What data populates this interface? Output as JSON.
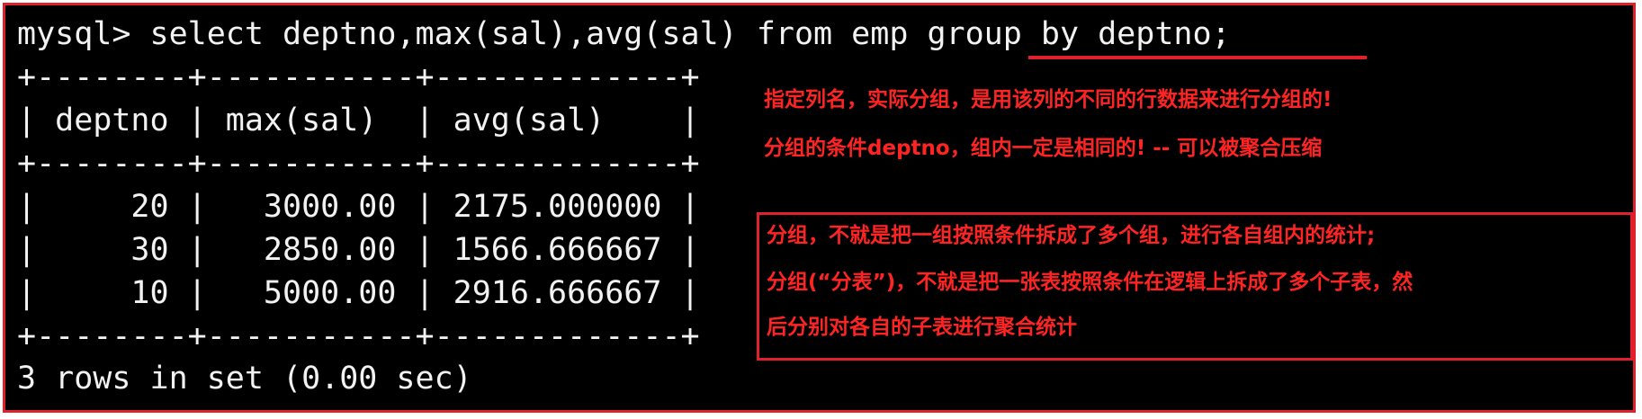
{
  "terminal": {
    "prompt": "mysql> ",
    "command": "select deptno,max(sal),avg(sal) from emp group by deptno;",
    "border_line": "+--------+-----------+-------------+",
    "header_row": "| deptno | max(sal)  | avg(sal)    |",
    "rows": [
      "|     20 |   3000.00 | 2175.000000 |",
      "|     30 |   2850.00 | 1566.666667 |",
      "|     10 |   5000.00 | 2916.666667 |"
    ],
    "footer": "3 rows in set (0.00 sec)"
  },
  "annotations": {
    "note1": "指定列名，实际分组，是用该列的不同的行数据来进行分组的!",
    "note2": "分组的条件deptno，组内一定是相同的! -- 可以被聚合压缩",
    "box_lines": [
      "分组，不就是把一组按照条件拆成了多个组，进行各自组内的统计;",
      "分组(“分表”)，不就是把一张表按照条件在逻辑上拆成了多个子表，然",
      "后分别对各自的子表进行聚合统计"
    ]
  },
  "colors": {
    "terminal_bg": "#000000",
    "terminal_fg": "#f2f2f2",
    "annotation_red": "#ff2424",
    "border_red": "#e0202a"
  }
}
